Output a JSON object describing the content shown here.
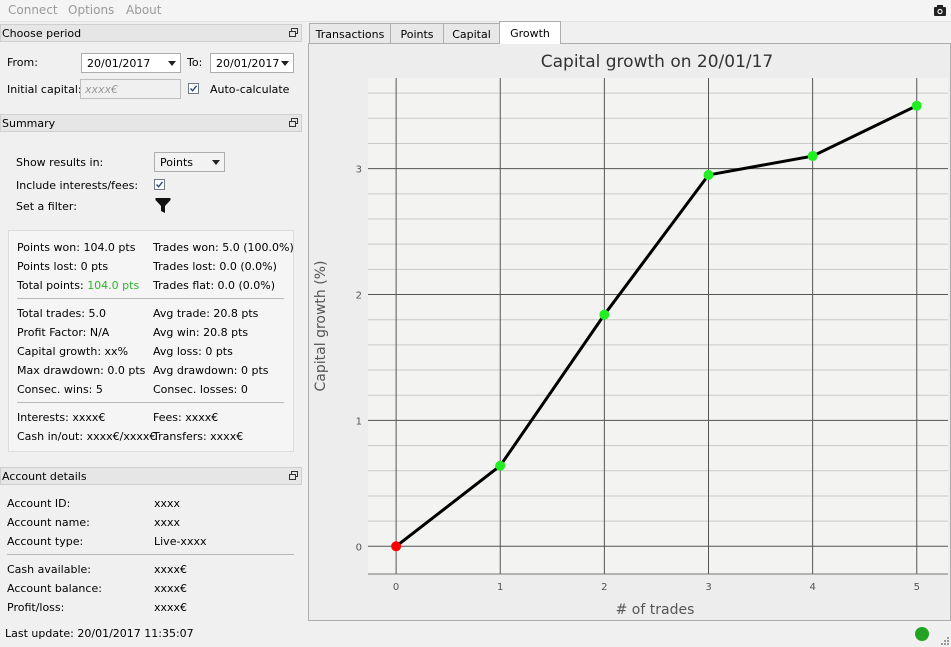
{
  "menu": {
    "items": [
      "Connect",
      "Options",
      "About"
    ]
  },
  "period": {
    "title": "Choose period",
    "from_label": "From:",
    "from_value": "20/01/2017",
    "to_label": "To:",
    "to_value": "20/01/2017",
    "initial_capital_label": "Initial capital:",
    "initial_capital_placeholder": "xxxx€",
    "auto_calculate_label": "Auto-calculate",
    "auto_calculate_checked": true
  },
  "summary": {
    "title": "Summary",
    "show_results_label": "Show results in:",
    "show_results_value": "Points",
    "include_fees_label": "Include interests/fees:",
    "include_fees_checked": true,
    "filter_label": "Set a filter:",
    "stats": {
      "points_won": "Points won: 104.0 pts",
      "trades_won": "Trades won: 5.0 (100.0%)",
      "points_lost": "Points lost: 0 pts",
      "trades_lost": "Trades lost: 0.0 (0.0%)",
      "total_points_label": "Total points:",
      "total_points_value": "104.0 pts",
      "total_points_color": "#2db52d",
      "trades_flat": "Trades flat: 0.0 (0.0%)",
      "total_trades": "Total trades: 5.0",
      "avg_trade": "Avg trade: 20.8 pts",
      "profit_factor": "Profit Factor: N/A",
      "avg_win": "Avg win: 20.8 pts",
      "capital_growth": "Capital growth: xx%",
      "avg_loss": "Avg loss: 0 pts",
      "max_drawdown": "Max drawdown: 0.0 pts",
      "avg_drawdown": "Avg drawdown: 0 pts",
      "consec_wins": "Consec. wins: 5",
      "consec_losses": "Consec. losses: 0",
      "interests": "Interests: xxxx€",
      "fees": "Fees: xxxx€",
      "cash_inout": "Cash in/out: xxxx€/xxxx€",
      "transfers": "Transfers: xxxx€"
    }
  },
  "account": {
    "title": "Account details",
    "id_label": "Account ID:",
    "id_value": "xxxx",
    "name_label": "Account name:",
    "name_value": "xxxx",
    "type_label": "Account type:",
    "type_value": "Live-xxxx",
    "cash_label": "Cash available:",
    "cash_value": "xxxx€",
    "balance_label": "Account balance:",
    "balance_value": "xxxx€",
    "pl_label": "Profit/loss:",
    "pl_value": "xxxx€"
  },
  "status": {
    "last_update": "Last update: 20/01/2017 11:35:07",
    "connection_color": "#23a321"
  },
  "tabs": [
    {
      "label": "Transactions",
      "active": false
    },
    {
      "label": "Points",
      "active": false
    },
    {
      "label": "Capital",
      "active": false
    },
    {
      "label": "Growth",
      "active": true
    }
  ],
  "chart_data": {
    "type": "line",
    "title": "Capital growth on 20/01/17",
    "xlabel": "# of trades",
    "ylabel": "Capital growth (%)",
    "x": [
      0,
      1,
      2,
      3,
      4,
      5
    ],
    "y": [
      0,
      0.64,
      1.84,
      2.95,
      3.1,
      3.5
    ],
    "point_colors": [
      "#ff0000",
      "#22ee22",
      "#22ee22",
      "#22ee22",
      "#22ee22",
      "#22ee22"
    ],
    "xlim": [
      -0.27,
      5.3
    ],
    "ylim": [
      -0.22,
      3.72
    ],
    "xticks": [
      0,
      1,
      2,
      3,
      4,
      5
    ],
    "yticks": [
      0,
      1,
      2,
      3
    ],
    "line_color": "#000000",
    "grid": true
  }
}
